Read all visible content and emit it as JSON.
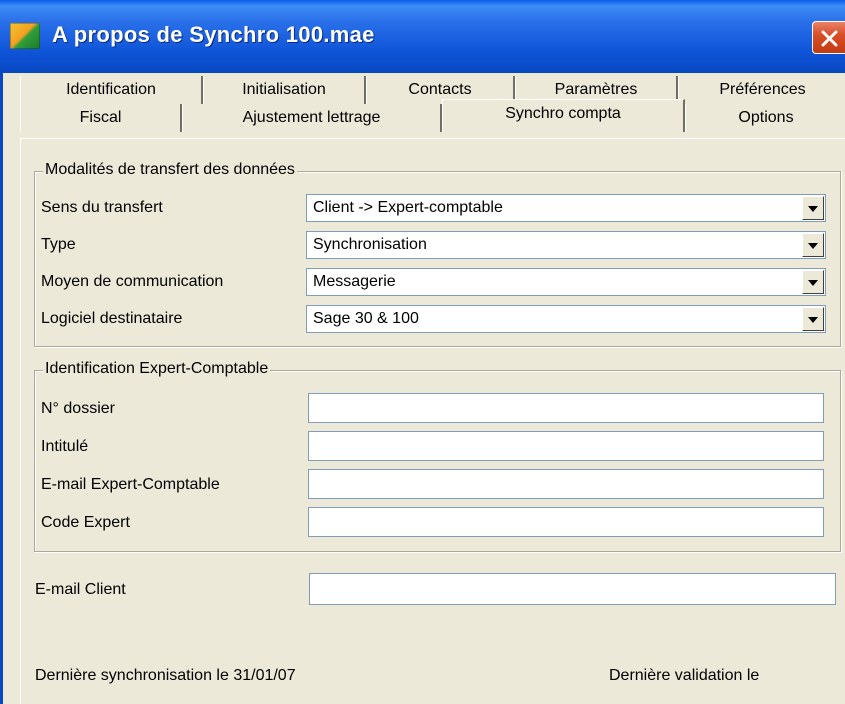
{
  "window": {
    "title": "A propos de Synchro 100.mae",
    "close_icon": "close-icon",
    "app_icon": "app-icon"
  },
  "tabs": {
    "row1": [
      "Identification",
      "Initialisation",
      "Contacts",
      "Paramètres",
      "Préférences"
    ],
    "row2": [
      "Fiscal",
      "Ajustement lettrage",
      "Synchro compta",
      "Options"
    ],
    "active": "Synchro compta"
  },
  "transfer_group": {
    "legend": "Modalités de transfert des données",
    "fields": [
      {
        "label": "Sens du transfert",
        "value": "Client -> Expert-comptable"
      },
      {
        "label": "Type",
        "value": "Synchronisation"
      },
      {
        "label": "Moyen de communication",
        "value": "Messagerie"
      },
      {
        "label": "Logiciel destinataire",
        "value": "Sage 30 & 100"
      }
    ]
  },
  "expert_group": {
    "legend": "Identification Expert-Comptable",
    "fields": [
      {
        "label": "N° dossier",
        "value": ""
      },
      {
        "label": "Intitulé",
        "value": ""
      },
      {
        "label": "E-mail Expert-Comptable",
        "value": ""
      },
      {
        "label": "Code Expert",
        "value": ""
      }
    ]
  },
  "client_email": {
    "label": "E-mail Client",
    "value": ""
  },
  "status": {
    "last_sync": "Dernière synchronisation le 31/01/07",
    "last_validation": "Dernière validation le"
  }
}
